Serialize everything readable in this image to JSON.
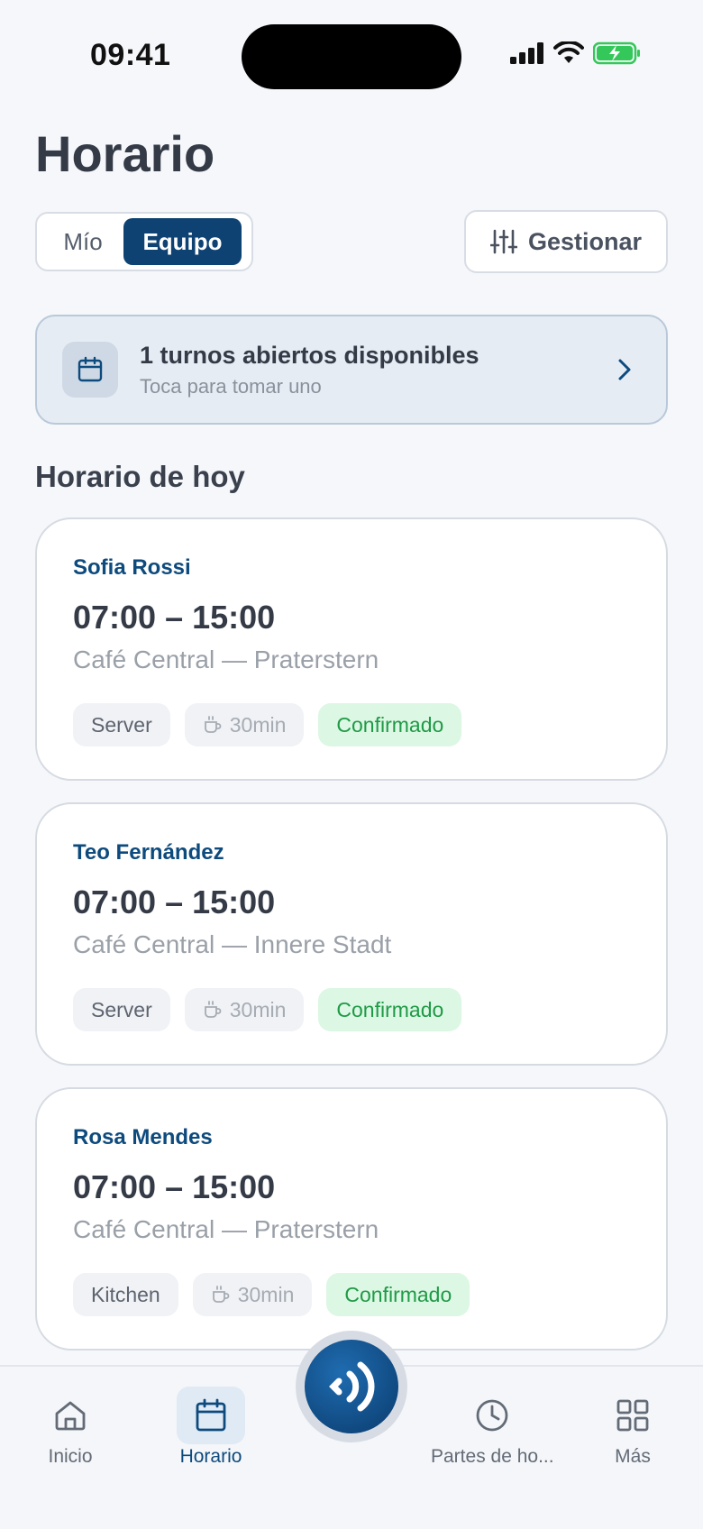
{
  "status_bar": {
    "time": "09:41"
  },
  "page_title": "Horario",
  "view_toggle": {
    "mine": "Mío",
    "team": "Equipo",
    "selected": "Equipo"
  },
  "manage_button": {
    "label": "Gestionar"
  },
  "open_shifts": {
    "title": "1 turnos abiertos disponibles",
    "subtitle": "Toca para tomar uno"
  },
  "today_heading": "Horario de hoy",
  "shifts": [
    {
      "name": "Sofia Rossi",
      "time": "07:00 – 15:00",
      "location": "Café Central — Praterstern",
      "role": "Server",
      "break": "30min",
      "status": "Confirmado"
    },
    {
      "name": "Teo Fernández",
      "time": "07:00 – 15:00",
      "location": "Café Central — Innere Stadt",
      "role": "Server",
      "break": "30min",
      "status": "Confirmado"
    },
    {
      "name": "Rosa Mendes",
      "time": "07:00 – 15:00",
      "location": "Café Central — Praterstern",
      "role": "Kitchen",
      "break": "30min",
      "status": "Confirmado"
    }
  ],
  "nav": {
    "home": "Inicio",
    "schedule": "Horario",
    "timesheets": "Partes de ho...",
    "more": "Más",
    "active": "schedule"
  },
  "colors": {
    "primary": "#0d4272",
    "accent_text": "#0d4a7d",
    "success_bg": "#dcf7e3",
    "success_text": "#1f9a47"
  }
}
